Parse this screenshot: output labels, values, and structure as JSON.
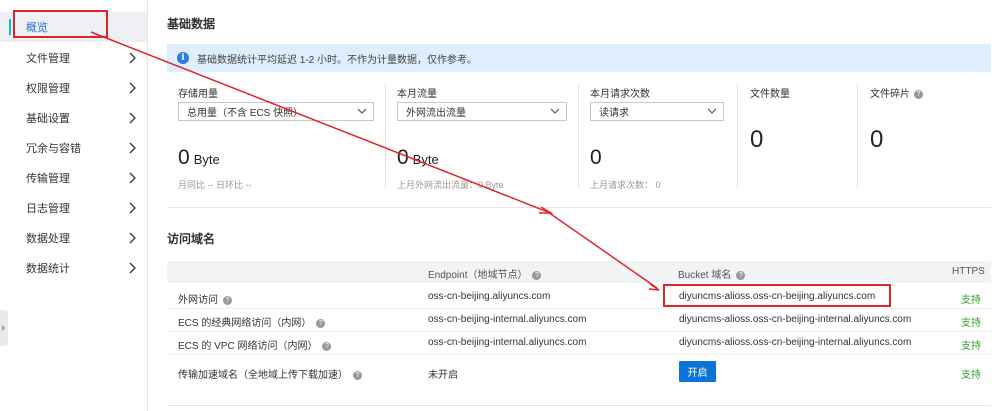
{
  "sidebar": {
    "items": [
      {
        "label": "概览",
        "active": true
      },
      {
        "label": "文件管理"
      },
      {
        "label": "权限管理"
      },
      {
        "label": "基础设置"
      },
      {
        "label": "冗余与容错"
      },
      {
        "label": "传输管理"
      },
      {
        "label": "日志管理"
      },
      {
        "label": "数据处理"
      },
      {
        "label": "数据统计"
      }
    ]
  },
  "basic": {
    "title": "基础数据",
    "notice": "基础数据统计平均延迟 1-2 小时。不作为计量数据，仅作参考。",
    "info_icon": "i",
    "cards": [
      {
        "label": "存储用量",
        "select": "总用量（不含 ECS 快照）",
        "value": "0",
        "unit": "Byte",
        "sub": "月同比 --   日环比 --"
      },
      {
        "label": "本月流量",
        "select": "外网流出流量",
        "value": "0",
        "unit": "Byte",
        "sub": "上月外网流出流量：0 Byte"
      },
      {
        "label": "本月请求次数",
        "select": "读请求",
        "value": "0",
        "sub": "上月请求次数：  0"
      },
      {
        "label": "文件数量",
        "value": "0"
      },
      {
        "label": "文件碎片",
        "value": "0",
        "help": "?"
      }
    ]
  },
  "domains": {
    "title": "访问域名",
    "headers": {
      "endpoint": "Endpoint（地域节点）",
      "bucket": "Bucket 域名",
      "https": "HTTPS",
      "help": "?"
    },
    "rows": [
      {
        "name": "外网访问",
        "endpoint": "oss-cn-beijing.aliyuncs.com",
        "bucket": "diyuncms-alioss.oss-cn-beijing.aliyuncs.com",
        "https": "支持"
      },
      {
        "name": "ECS 的经典网络访问（内网）",
        "endpoint": "oss-cn-beijing-internal.aliyuncs.com",
        "bucket": "diyuncms-alioss.oss-cn-beijing-internal.aliyuncs.com",
        "https": "支持"
      },
      {
        "name": "ECS 的 VPC 网络访问（内网）",
        "endpoint": "oss-cn-beijing-internal.aliyuncs.com",
        "bucket": "diyuncms-alioss.oss-cn-beijing-internal.aliyuncs.com",
        "https": "支持"
      },
      {
        "name": "传输加速域名（全地域上传下载加速）",
        "endpoint": "未开启",
        "button": "开启",
        "https": "支持"
      }
    ]
  },
  "colors": {
    "accent": "#0b74d6",
    "annotation": "#e0242a",
    "success": "#2fa22f",
    "notice_bg": "#dfeefc"
  }
}
